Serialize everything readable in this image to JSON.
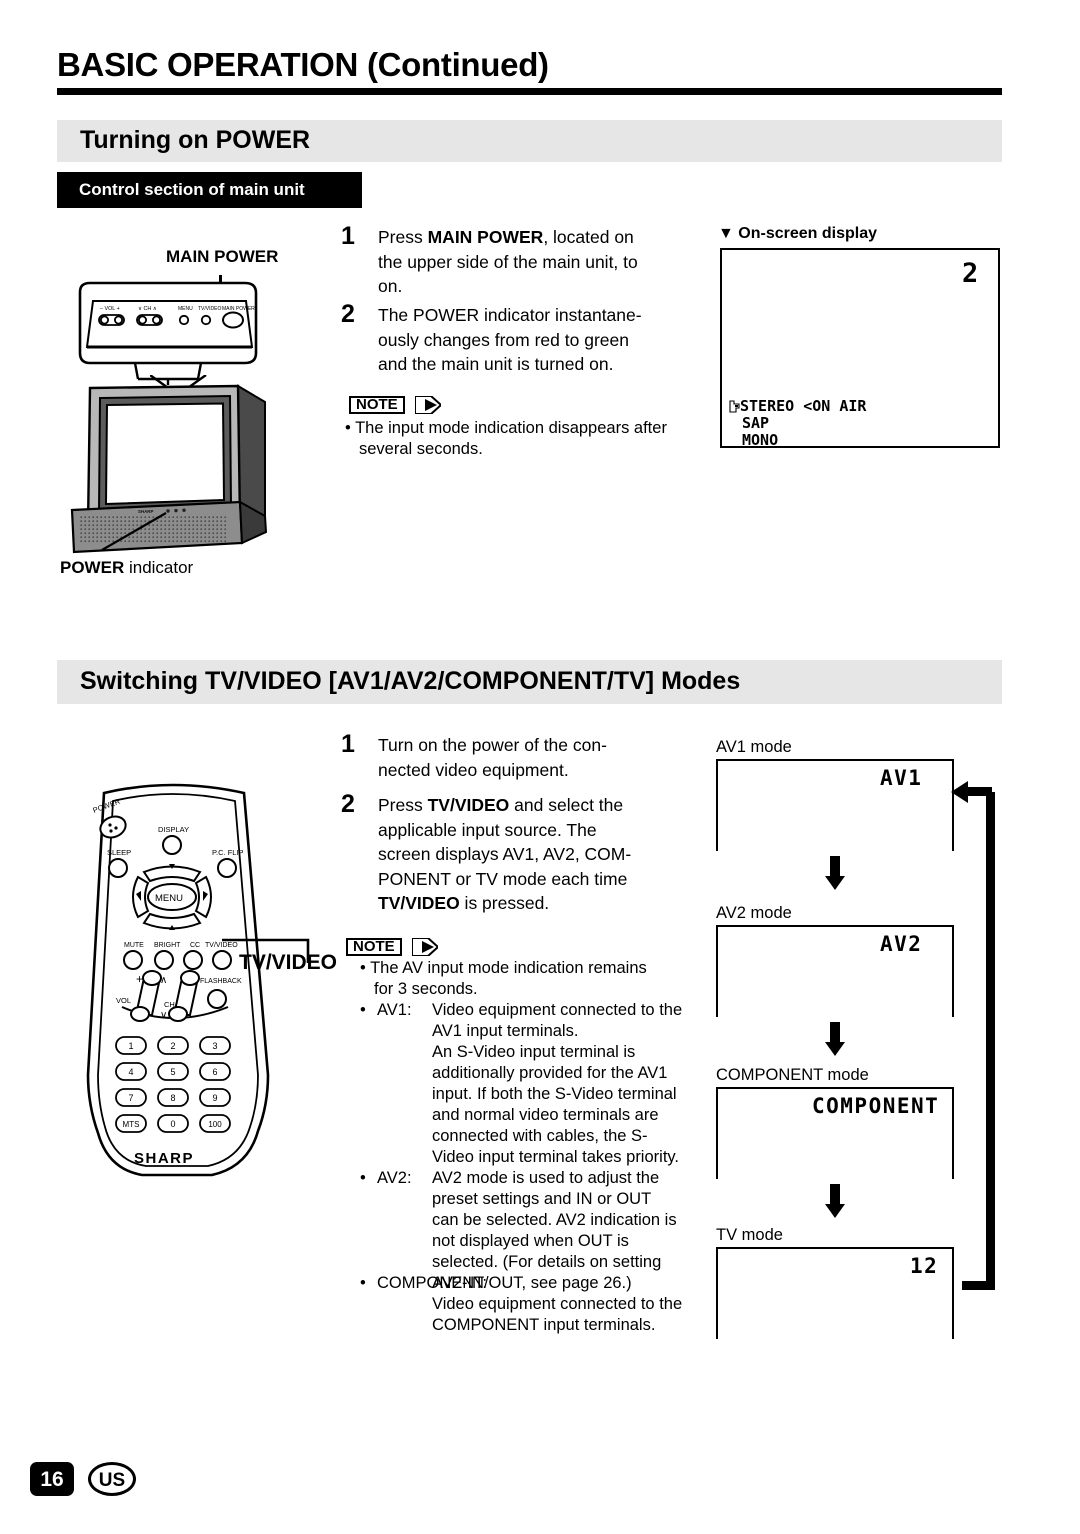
{
  "document": {
    "title": "BASIC OPERATION (Continued)",
    "page_number": "16",
    "region_code": "US"
  },
  "section1": {
    "heading": "Turning on POWER",
    "subheading": "Control section of main unit",
    "steps": [
      {
        "num": "1",
        "lines": [
          "Press ",
          "MAIN POWER",
          ", located on the upper side of the main unit, to on."
        ]
      },
      {
        "num": "2",
        "text": "The POWER indicator instantane-ously changes from red to green and the main unit is turned on."
      }
    ],
    "step1_pre": "Press ",
    "step1_bold": "MAIN POWER",
    "step1_post": ", located on",
    "step1_l2": "the upper side of the main unit, to",
    "step1_l3": "on.",
    "step2_l1": "The POWER indicator instantane-",
    "step2_l2": "ously changes from red to green",
    "step2_l3": "and the main unit is turned on.",
    "note_label": "NOTE",
    "note_bullet": "•",
    "note_l1": "The input mode indication disappears after",
    "note_l2": "several seconds.",
    "diagram": {
      "main_power_label": "MAIN POWER",
      "power_indicator_label_bold": "POWER",
      "power_indicator_label_rest": " indicator",
      "panel_buttons": [
        "– VOL +",
        "∨ CH ∧",
        "MENU",
        "TV/VIDEO",
        "MAIN POWER"
      ],
      "brand": "SHARP"
    },
    "osd": {
      "caption_arrow": "▼",
      "caption": "On-screen display",
      "channel": "2",
      "line1": "STEREO <ON AIR",
      "line2": "SAP",
      "line3": "MONO",
      "cursor_icon": "hand-pointer-icon"
    }
  },
  "section2": {
    "heading": "Switching TV/VIDEO [AV1/AV2/COMPONENT/TV] Modes",
    "step1_num": "1",
    "step1_l1": "Turn on the power of the con-",
    "step1_l2": "nected video equipment.",
    "step2_num": "2",
    "step2_pre": "Press ",
    "step2_bold": "TV/VIDEO",
    "step2_post": " and select the",
    "step2_l2": "applicable input source. The",
    "step2_l3": "screen displays AV1, AV2, COM-",
    "step2_l4": "PONENT or TV mode each time",
    "step2_l5_bold": "TV/VIDEO",
    "step2_l5_post": " is pressed.",
    "note_label": "NOTE",
    "notes": [
      {
        "bullet": "•",
        "term": "",
        "lines": [
          "The AV input mode indication remains",
          "for 3 seconds."
        ]
      },
      {
        "bullet": "•",
        "term": "AV1:",
        "lines": [
          "Video equipment connected to the",
          "AV1 input terminals.",
          "An S-Video input terminal is",
          "additionally provided for the AV1",
          "input. If both the S-Video terminal",
          "and normal video terminals are",
          "connected with cables, the S-",
          "Video input terminal takes priority."
        ]
      },
      {
        "bullet": "•",
        "term": "AV2:",
        "lines": [
          "AV2 mode is used to adjust the",
          "preset settings and IN or OUT",
          "can be selected. AV2 indication is",
          "not displayed when OUT is",
          "selected. (For details on setting",
          "AV2-IN/OUT, see page 26.)"
        ]
      },
      {
        "bullet": "•",
        "term": "COMPONENT:",
        "lines": [
          "Video equipment connected to the",
          "COMPONENT input terminals."
        ]
      }
    ],
    "remote": {
      "callout_label": "TV/VIDEO",
      "brand": "SHARP",
      "buttons": [
        "POWER",
        "DISPLAY",
        "SLEEP",
        "P.C. FLIP",
        "MENU",
        "MUTE",
        "BRIGHT",
        "CC",
        "TV/VIDEO",
        "VOL",
        "CH",
        "FLASHBACK"
      ],
      "keypad": [
        "1",
        "2",
        "3",
        "4",
        "5",
        "6",
        "7",
        "8",
        "9",
        "MTS",
        "0",
        "100"
      ]
    },
    "modes": [
      {
        "caption": "AV1 mode",
        "value": "AV1"
      },
      {
        "caption": "AV2 mode",
        "value": "AV2"
      },
      {
        "caption": "COMPONENT mode",
        "value": "COMPONENT"
      },
      {
        "caption": "TV mode",
        "value": "12"
      }
    ]
  },
  "colors": {
    "band": "#e6e6e6",
    "ink": "#000000",
    "paper": "#ffffff"
  }
}
